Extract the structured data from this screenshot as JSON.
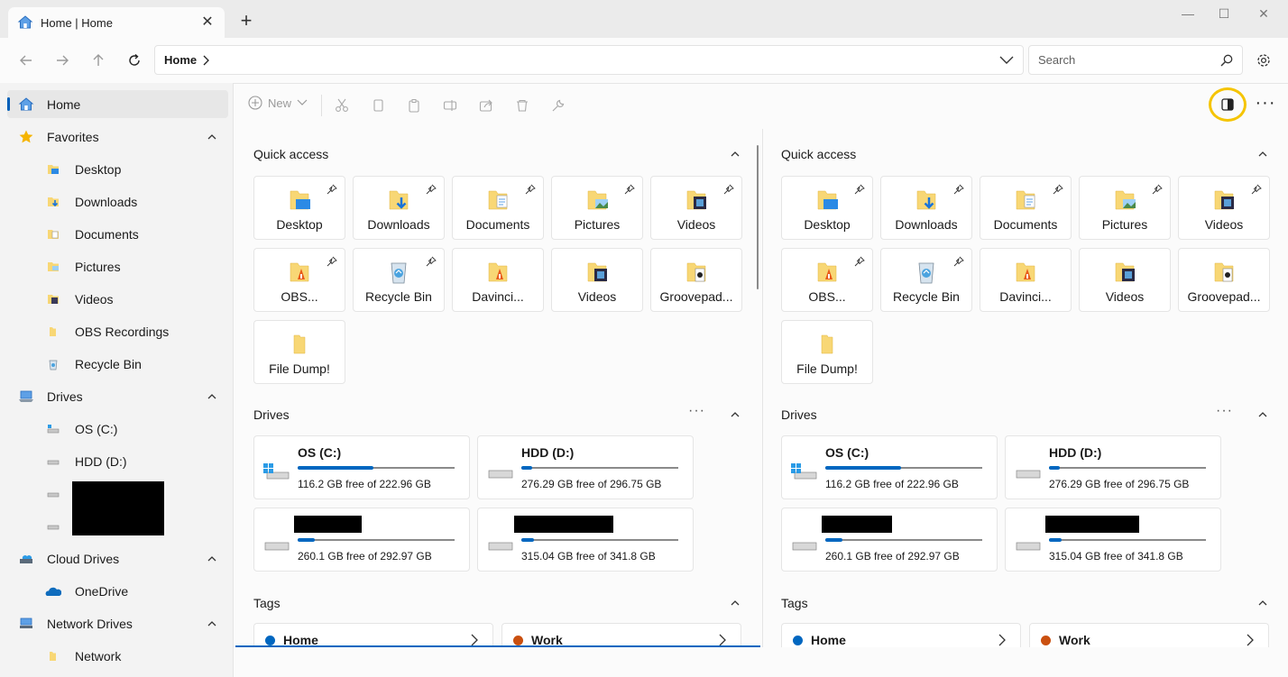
{
  "window": {
    "tab_title": "Home | Home",
    "new_tab": "+",
    "minimize": "—",
    "maximize": "☐",
    "close": "✕"
  },
  "address": {
    "crumb": "Home",
    "search_placeholder": "Search"
  },
  "sidebar": {
    "home": "Home",
    "favorites": "Favorites",
    "favorites_items": [
      "Desktop",
      "Downloads",
      "Documents",
      "Pictures",
      "Videos",
      "OBS Recordings",
      "Recycle Bin"
    ],
    "drives": "Drives",
    "drives_items": [
      "OS (C:)",
      "HDD (D:)"
    ],
    "cloud": "Cloud Drives",
    "cloud_items": [
      "OneDrive"
    ],
    "network": "Network Drives",
    "network_items": [
      "Network"
    ]
  },
  "toolbar": {
    "new_label": "New",
    "more": "···"
  },
  "panes": [
    {
      "quick_access_title": "Quick access",
      "quick_items": [
        "Desktop",
        "Downloads",
        "Documents",
        "Pictures",
        "Videos",
        "OBS...",
        "Recycle Bin",
        "Davinci...",
        "Videos",
        "Groovepad...",
        "File Dump!"
      ],
      "drives_title": "Drives",
      "drives_more": "···",
      "drives": [
        {
          "name": "OS (C:)",
          "free": "116.2 GB free of 222.96 GB",
          "used_fraction": 0.48
        },
        {
          "name": "HDD (D:)",
          "free": "276.29 GB free of 296.75 GB",
          "used_fraction": 0.07
        },
        {
          "name": "",
          "free": "260.1 GB free of 292.97 GB",
          "used_fraction": 0.11
        },
        {
          "name": "",
          "free": "315.04 GB free of 341.8 GB",
          "used_fraction": 0.08
        }
      ],
      "tags_title": "Tags",
      "tags": [
        {
          "name": "Home",
          "color": "#0067c0"
        },
        {
          "name": "Work",
          "color": "#ca5010"
        }
      ]
    },
    {
      "quick_access_title": "Quick access",
      "quick_items": [
        "Desktop",
        "Downloads",
        "Documents",
        "Pictures",
        "Videos",
        "OBS...",
        "Recycle Bin",
        "Davinci...",
        "Videos",
        "Groovepad...",
        "File Dump!"
      ],
      "drives_title": "Drives",
      "drives_more": "···",
      "drives": [
        {
          "name": "OS (C:)",
          "free": "116.2 GB free of 222.96 GB",
          "used_fraction": 0.48
        },
        {
          "name": "HDD (D:)",
          "free": "276.29 GB free of 296.75 GB",
          "used_fraction": 0.07
        },
        {
          "name": "",
          "free": "260.1 GB free of 292.97 GB",
          "used_fraction": 0.11
        },
        {
          "name": "",
          "free": "315.04 GB free of 341.8 GB",
          "used_fraction": 0.08
        }
      ],
      "tags_title": "Tags",
      "tags": [
        {
          "name": "Home",
          "color": "#0067c0"
        },
        {
          "name": "Work",
          "color": "#ca5010"
        }
      ]
    }
  ]
}
